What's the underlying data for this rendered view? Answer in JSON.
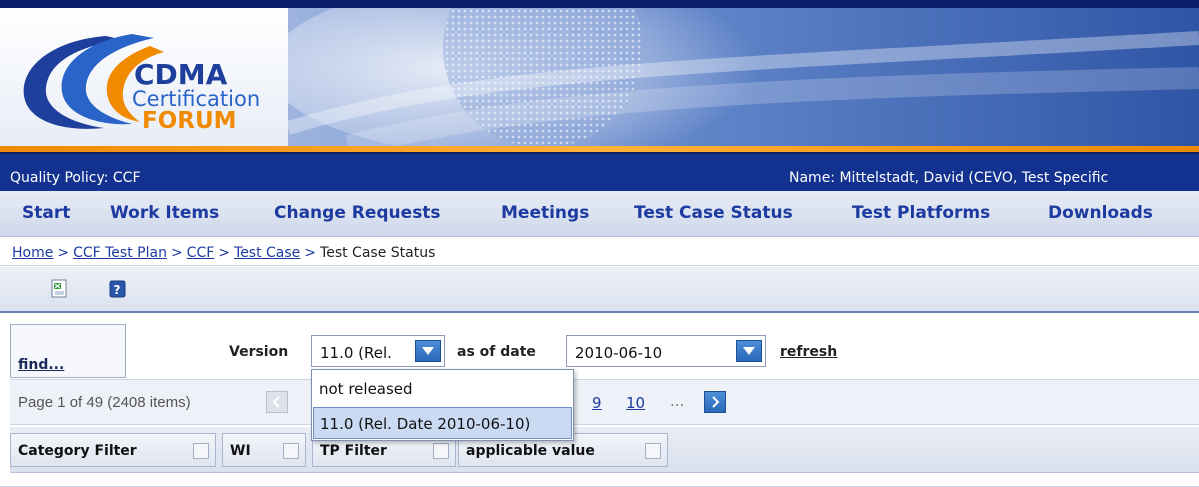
{
  "logo": {
    "line1": "CDMA",
    "line2": "Certification",
    "line3": "FORUM"
  },
  "info_bar": {
    "left": "Quality Policy: CCF",
    "right": "Name: Mittelstadt, David (CEVO, Test Specific"
  },
  "nav": {
    "items": [
      {
        "label": "Start"
      },
      {
        "label": "Work Items"
      },
      {
        "label": "Change Requests"
      },
      {
        "label": "Meetings"
      },
      {
        "label": "Test Case Status"
      },
      {
        "label": "Test Platforms"
      },
      {
        "label": "Downloads"
      }
    ]
  },
  "breadcrumb": {
    "items": [
      "Home",
      "CCF Test Plan",
      "CCF",
      "Test Case"
    ],
    "current": "Test Case Status",
    "separator": ">"
  },
  "toolbar": {
    "icons": [
      "excel-export-icon",
      "help-icon"
    ]
  },
  "filters": {
    "find_label": "find...",
    "version_label": "Version",
    "version_value": "11.0 (Rel.",
    "date_label": "as of date",
    "date_value": "2010-06-10",
    "refresh_label": "refresh"
  },
  "version_options": [
    {
      "label": "not released",
      "selected": false
    },
    {
      "label": "11.0 (Rel. Date 2010-06-10)",
      "selected": true
    }
  ],
  "pager": {
    "summary": "Page 1 of 49 (2408 items)",
    "visible_pages": [
      "9",
      "10"
    ],
    "ellipsis": "..."
  },
  "filter_headers": [
    {
      "label": "Category Filter"
    },
    {
      "label": "WI"
    },
    {
      "label": "TP Filter"
    },
    {
      "label": "applicable value"
    }
  ],
  "colors": {
    "nav_text": "#1d3aa1",
    "info_bar_bg": "#13328f",
    "accent_orange": "#f08a00",
    "dropdown_selected": "#c9daf2"
  }
}
